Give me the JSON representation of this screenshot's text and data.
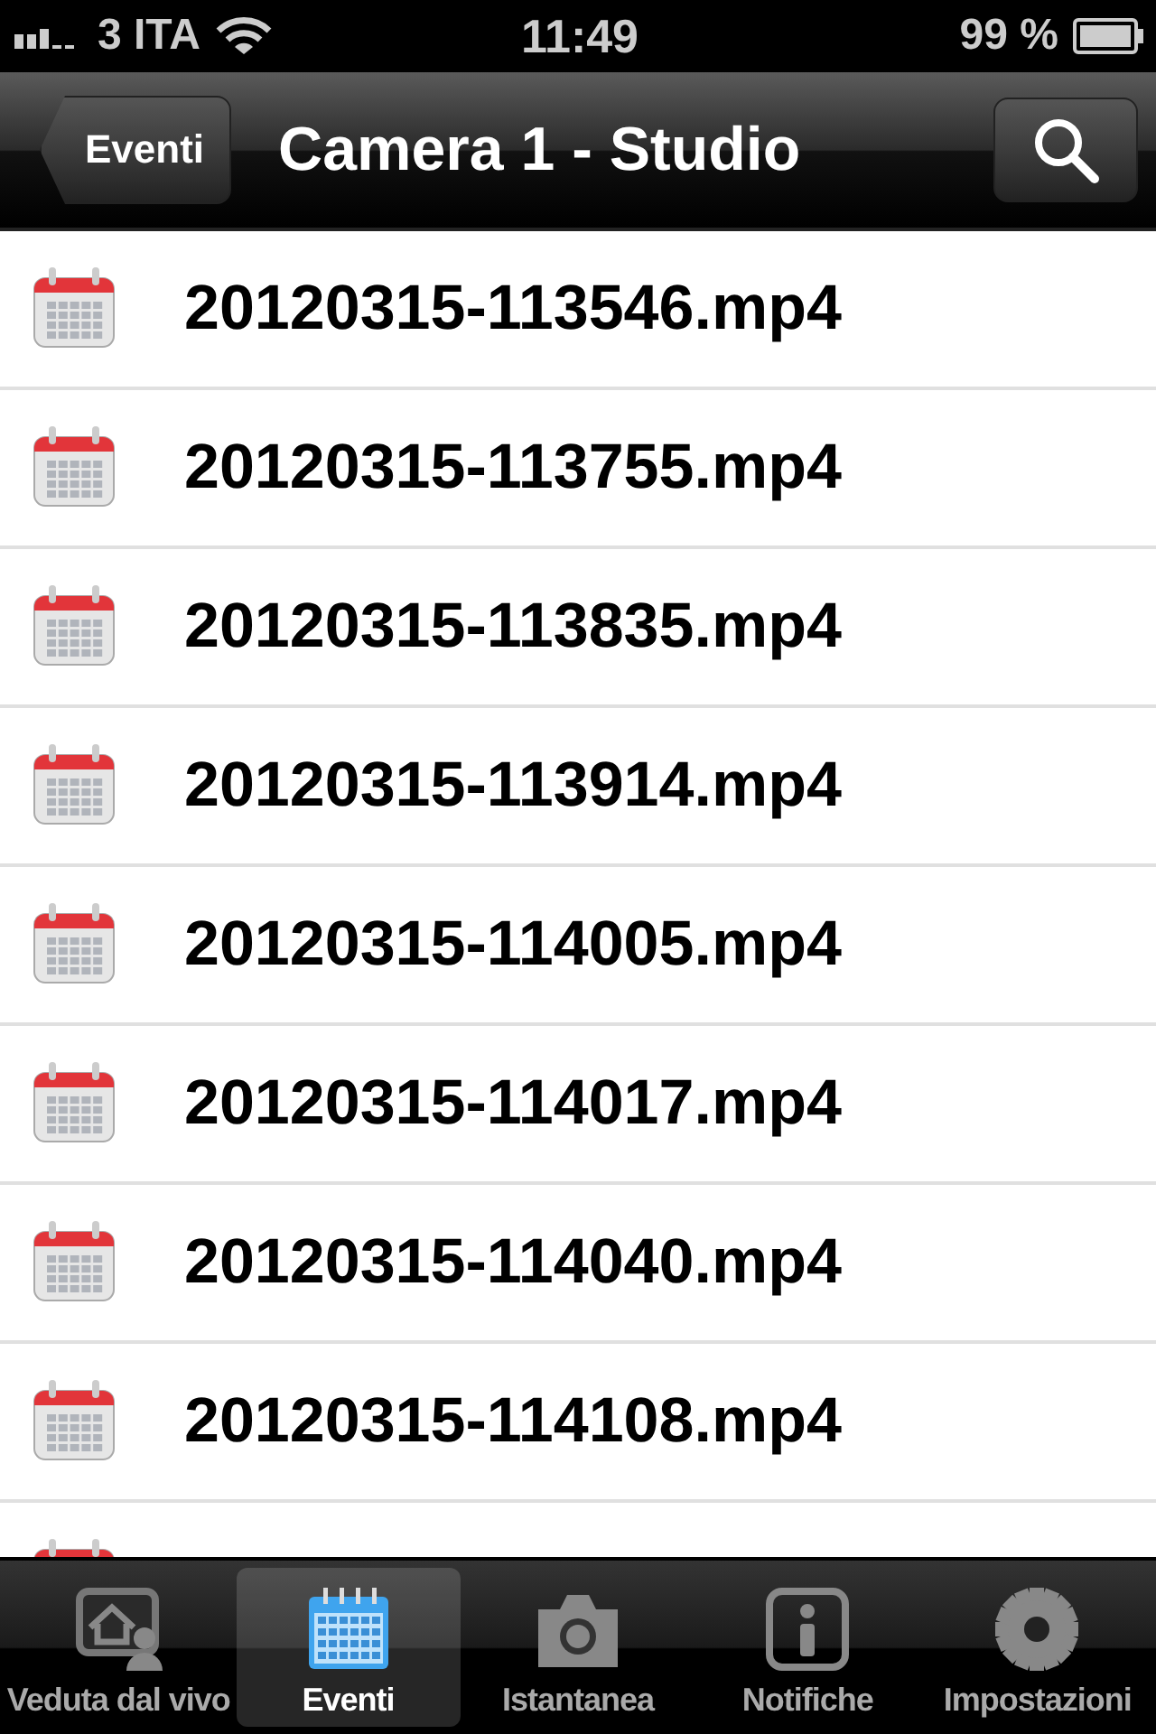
{
  "status_bar": {
    "carrier": "3 ITA",
    "time": "11:49",
    "battery": "99 %"
  },
  "nav_bar": {
    "back": "Eventi",
    "title": "Camera 1 - Studio"
  },
  "files": [
    {
      "name": "20120315-113546.mp4"
    },
    {
      "name": "20120315-113755.mp4"
    },
    {
      "name": "20120315-113835.mp4"
    },
    {
      "name": "20120315-113914.mp4"
    },
    {
      "name": "20120315-114005.mp4"
    },
    {
      "name": "20120315-114017.mp4"
    },
    {
      "name": "20120315-114040.mp4"
    },
    {
      "name": "20120315-114108.mp4"
    }
  ],
  "tabs": [
    {
      "kind": "live",
      "label": "Veduta dal vivo",
      "selected": false
    },
    {
      "kind": "events",
      "label": "Eventi",
      "selected": true
    },
    {
      "kind": "snapshot",
      "label": "Istantanea",
      "selected": false
    },
    {
      "kind": "notifications",
      "label": "Notifiche",
      "selected": false
    },
    {
      "kind": "settings",
      "label": "Impostazioni",
      "selected": false
    }
  ]
}
